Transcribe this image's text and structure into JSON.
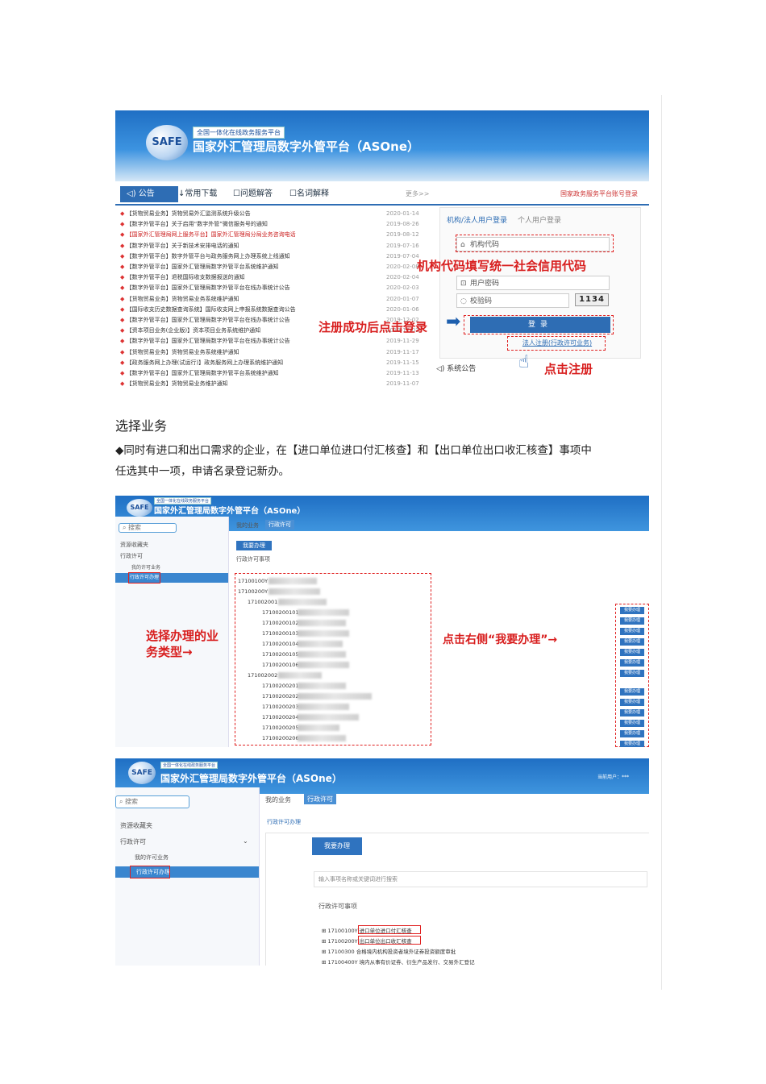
{
  "screenshot1": {
    "platform_label": "全国一体化在线政务服务平台",
    "app_title": "国家外汇管理局数字外管平台（ASOne）",
    "logo_text": "SAFE",
    "tabs": [
      "公告",
      "常用下载",
      "问题解答",
      "名词解释"
    ],
    "more_label": "更多>>",
    "gov_link": "国家政务服务平台账号登录",
    "notices": [
      {
        "text": "【货物贸易业务】货物贸易外汇监测系统升级公告",
        "date": "2020-01-14"
      },
      {
        "text": "【数字外管平台】关于启用“数字外管”微信服务号的通知",
        "date": "2019-08-26"
      },
      {
        "text": "【国家外汇管理局网上服务平台】国家外汇管理局分局业务咨询电话",
        "date": "2019-08-12"
      },
      {
        "text": "【数字外管平台】关于新技术安排电话的通知",
        "date": "2019-07-16"
      },
      {
        "text": "【数字外管平台】数字外管平台与政务服务网上办理系统上线通知",
        "date": "2019-07-04"
      },
      {
        "text": "【数字外管平台】国家外汇管理局数字外管平台系统维护通知",
        "date": "2020-02-08"
      },
      {
        "text": "【数字外管平台】退税国际收支数据报送的通知",
        "date": "2020-02-04"
      },
      {
        "text": "【数字外管平台】国家外汇管理局数字外管平台在线办事统计公告",
        "date": "2020-02-03"
      },
      {
        "text": "【货物贸易业务】货物贸易业务系统维护通知",
        "date": "2020-01-07"
      },
      {
        "text": "【国际收支历史数据查询系统】国际收支网上申报系统数据查询公告",
        "date": "2020-01-06"
      },
      {
        "text": "【数字外管平台】国家外汇管理局数字外管平台在线办事统计公告",
        "date": "2019-12-02"
      },
      {
        "text": "【资本项目业务(企业版)】资本项目业务系统维护通知",
        "date": "2019-12-02"
      },
      {
        "text": "【数字外管平台】国家外汇管理局数字外管平台在线办事统计公告",
        "date": "2019-11-29"
      },
      {
        "text": "【货物贸易业务】货物贸易业务系统维护通知",
        "date": "2019-11-17"
      },
      {
        "text": "【政务服务网上办理(试运行)】政务服务网上办理系统维护通知",
        "date": "2019-11-15"
      },
      {
        "text": "【数字外管平台】国家外汇管理局数字外管平台系统维护通知",
        "date": "2019-11-13"
      },
      {
        "text": "【货物贸易业务】货物贸易业务维护通知",
        "date": "2019-11-07"
      }
    ],
    "login_tabs": {
      "org": "机构/法人用户登录",
      "personal": "个人用户登录"
    },
    "fields": {
      "org_code": "机构代码",
      "password": "用户密码",
      "captcha": "校验码"
    },
    "captcha_value": "1134",
    "login_button": "登录",
    "register_link": "法人注册(行政许可业务)",
    "system_notice": "系统公告",
    "annotations": {
      "org_code_hint": "机构代码填写统一社会信用代码",
      "login_hint": "注册成功后点击登录",
      "register_hint": "点击注册"
    },
    "colors": {
      "brand": "#2e6db4",
      "annotation": "#d81e1e"
    }
  },
  "section_title": "选择业务",
  "paragraph": "◆同时有进口和出口需求的企业，在【进口单位进口付汇核查】和【出口单位出口收汇核查】事项中任选其中一项，申请名录登记新办。",
  "screenshot2": {
    "platform_label": "全国一体化在线政务服务平台",
    "app_title": "国家外汇管理局数字外管平台（ASOne）",
    "logo_text": "SAFE",
    "search_label": "搜索",
    "sidebar": [
      "资源收藏夹",
      "行政许可",
      "我的许可业务",
      "行政许可办理"
    ],
    "subtabs": [
      "我的业务",
      "行政许可"
    ],
    "want_button": "我要办理",
    "section_label": "行政许可事项",
    "codes": [
      "17100100Y",
      "17100200Y",
      "171002001",
      "17100200101",
      "17100200102",
      "17100200103",
      "17100200104",
      "17100200105",
      "17100200106",
      "171002002",
      "17100200201",
      "17100200202",
      "17100200203",
      "17100200204",
      "17100200205",
      "17100200206"
    ],
    "row_button": "我要办理",
    "annotations": {
      "left": "选择办理的业务类型→",
      "right": "点击右侧“我要办理”→"
    }
  },
  "screenshot3": {
    "platform_label": "全国一体化在线政务服务平台",
    "app_title": "国家外汇管理局数字外管平台（ASOne）",
    "logo_text": "SAFE",
    "user_label": "当前用户：***",
    "search_label": "搜索",
    "sidebar": [
      "资源收藏夹",
      "行政许可",
      "我的许可业务",
      "行政许可办理"
    ],
    "subtabs": [
      "我的业务",
      "行政许可"
    ],
    "breadcrumb": "行政许可办理",
    "want_button": "我要办理",
    "search_placeholder": "输入事项名称或关键词进行搜索",
    "section_label": "行政许可事项",
    "items": [
      {
        "code": "17100100Y",
        "name": "进口单位进口付汇核查"
      },
      {
        "code": "17100200Y",
        "name": "出口单位出口收汇核查"
      },
      {
        "code": "17100300",
        "name": "合格境内机构投资者境外证券投资额度审批"
      },
      {
        "code": "17100400Y",
        "name": "境内从事有价证券、衍生产品发行、交易外汇登记"
      }
    ]
  }
}
